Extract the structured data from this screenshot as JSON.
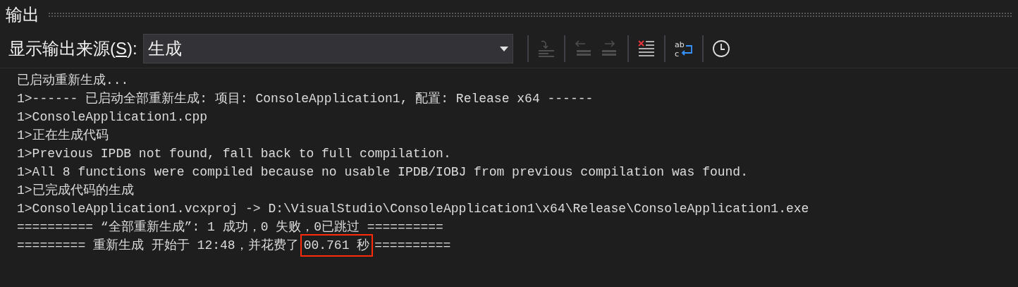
{
  "panel": {
    "title": "输出"
  },
  "source": {
    "label_before": "显示输出来源(",
    "access_key": "S",
    "label_after": "):",
    "value": "生成"
  },
  "toolbar_groups": [
    [
      {
        "kind": "goto",
        "disabled": true
      }
    ],
    [
      {
        "kind": "previous",
        "disabled": true
      },
      {
        "kind": "next",
        "disabled": true
      }
    ],
    [
      {
        "kind": "clear",
        "disabled": false
      }
    ],
    [
      {
        "kind": "wrap",
        "disabled": false,
        "top_text": "ab",
        "bottom_text": "c"
      }
    ],
    [
      {
        "kind": "clock",
        "disabled": false
      }
    ]
  ],
  "lines": [
    {
      "text": "已启动重新生成..."
    },
    {
      "text": "1>------ 已启动全部重新生成: 项目: ConsoleApplication1, 配置: Release x64 ------"
    },
    {
      "text": "1>ConsoleApplication1.cpp"
    },
    {
      "text": "1>正在生成代码"
    },
    {
      "text": "1>Previous IPDB not found, fall back to full compilation."
    },
    {
      "text": "1>All 8 functions were compiled because no usable IPDB/IOBJ from previous compilation was found."
    },
    {
      "text": "1>已完成代码的生成"
    },
    {
      "text": "1>ConsoleApplication1.vcxproj -> D:\\VisualStudio\\ConsoleApplication1\\x64\\Release\\ConsoleApplication1.exe"
    },
    {
      "text": "========== “全部重新生成”: 1 成功，0 失败，0已跳过 =========="
    },
    {
      "text": "========= 重新生成 开始于 12:48，并花费了",
      "highlight": "00.761 秒",
      "tail": "=========="
    }
  ]
}
